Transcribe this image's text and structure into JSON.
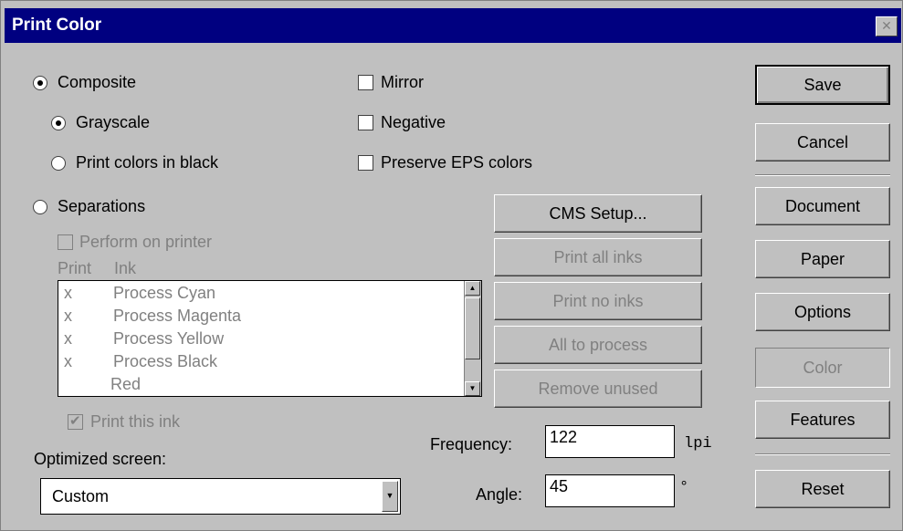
{
  "title": "Print Color",
  "close_icon": "close-icon",
  "composite": {
    "label": "Composite",
    "grayscale": "Grayscale",
    "print_colors_black": "Print colors in black"
  },
  "options": {
    "mirror": "Mirror",
    "negative": "Negative",
    "preserve_eps": "Preserve EPS colors"
  },
  "separations": {
    "label": "Separations",
    "perform_on_printer": "Perform on printer",
    "col_print": "Print",
    "col_ink": "Ink",
    "inks": [
      {
        "mark": "x",
        "name": "Process Cyan"
      },
      {
        "mark": "x",
        "name": "Process Magenta"
      },
      {
        "mark": "x",
        "name": "Process Yellow"
      },
      {
        "mark": "x",
        "name": "Process Black"
      },
      {
        "mark": "",
        "name": "Red"
      }
    ],
    "print_this_ink": "Print this ink"
  },
  "middle_buttons": {
    "cms_setup": "CMS Setup...",
    "print_all_inks": "Print all inks",
    "print_no_inks": "Print no inks",
    "all_to_process": "All to process",
    "remove_unused": "Remove unused"
  },
  "screen": {
    "optimized_label": "Optimized screen:",
    "optimized_value": "Custom",
    "frequency_label": "Frequency:",
    "frequency_value": "122",
    "frequency_unit": "lpi",
    "angle_label": "Angle:",
    "angle_value": "45",
    "angle_unit": "°"
  },
  "right_buttons": {
    "save": "Save",
    "cancel": "Cancel",
    "document": "Document",
    "paper": "Paper",
    "options": "Options",
    "color": "Color",
    "features": "Features",
    "reset": "Reset"
  }
}
